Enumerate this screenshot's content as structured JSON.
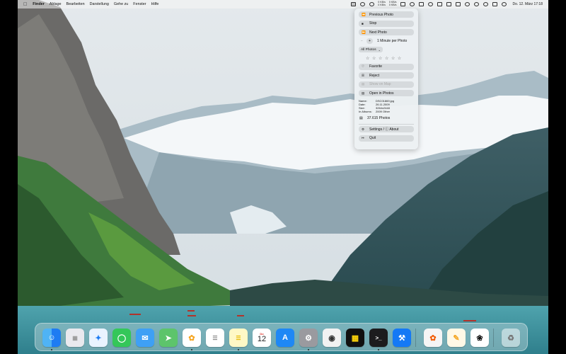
{
  "menubar": {
    "app": "Finder",
    "items": [
      "Ablage",
      "Bearbeiten",
      "Darstellung",
      "Gehe zu",
      "Fenster",
      "Hilfe"
    ],
    "stacked_text_1": "0 KB/s\n0 KB/s",
    "stacked_text_2": "0 KB/s\n0 KB/s",
    "clock": "Do. 12. März  17:18"
  },
  "popover": {
    "previous": "Previous Photo",
    "stop": "Stop",
    "next": "Next Photo",
    "stepper_minus": "−",
    "stepper_plus": "+",
    "interval": "1 Minute per Photo",
    "album_select": "All Photos",
    "favorite": "Favorite",
    "reject": "Reject",
    "show_on_map": "Show on Map",
    "open_in_photos": "Open in Photos",
    "info": [
      {
        "key": "Name:",
        "value": "DSC01869.jpg"
      },
      {
        "key": "Date:",
        "value": "26.11.2009"
      },
      {
        "key": "Size:",
        "value": "3264x2448"
      },
      {
        "key": "In Albums:",
        "value": "2009 Other"
      }
    ],
    "photo_count": "37.615 Photos",
    "settings": "Settings / ⓘ About",
    "quit": "Quit"
  },
  "dock": {
    "calendar_month": "Do",
    "calendar_day": "12"
  },
  "colors": {
    "accent": "#1e7cf2",
    "popover_bg": "#ecf0f2"
  }
}
